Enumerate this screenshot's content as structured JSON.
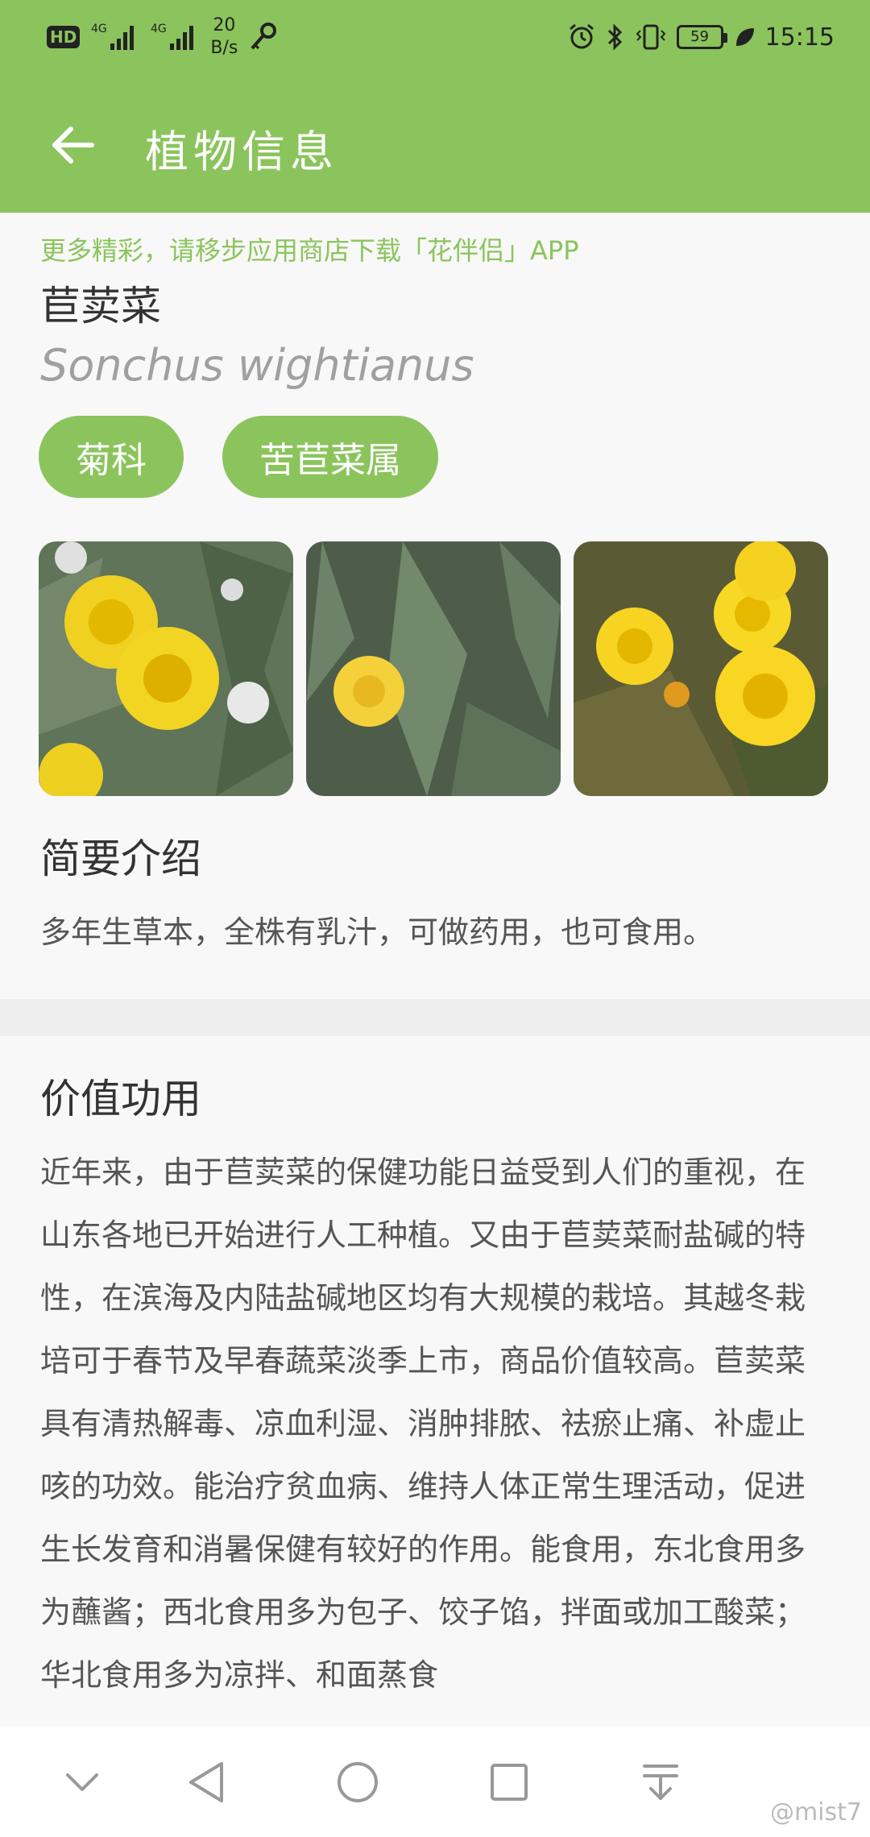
{
  "status_bar": {
    "hd": "HD",
    "signal1": "4G",
    "signal2": "4G",
    "speed_value": "20",
    "speed_unit": "B/s",
    "battery": "59",
    "time": "15:15"
  },
  "app_bar": {
    "title": "植物信息"
  },
  "content": {
    "promo": "更多精彩，请移步应用商店下载「花伴侣」APP",
    "name": "苣荬菜",
    "latin": "Sonchus wightianus",
    "tags": [
      "菊科",
      "苦苣菜属"
    ],
    "intro_title": "简要介绍",
    "intro_text": "多年生草本，全株有乳汁，可做药用，也可食用。",
    "value_title": "价值功用",
    "value_text": "近年来，由于苣荬菜的保健功能日益受到人们的重视，在山东各地已开始进行人工种植。又由于苣荬菜耐盐碱的特性，在滨海及内陆盐碱地区均有大规模的栽培。其越冬栽培可于春节及早春蔬菜淡季上市，商品价值较高。苣荬菜具有清热解毒、凉血利湿、消肿排脓、祛瘀止痛、补虚止咳的功效。能治疗贫血病、维持人体正常生理活动，促进生长发育和消暑保健有较好的作用。能食用，东北食用多为蘸酱；西北食用多为包子、饺子馅，拌面或加工酸菜；华北食用多为凉拌、和面蒸食"
  },
  "watermark": "@mist7",
  "colors": {
    "brand_green": "#8bc45c",
    "background": "#f8f8f8",
    "divider": "#eeeeee"
  }
}
